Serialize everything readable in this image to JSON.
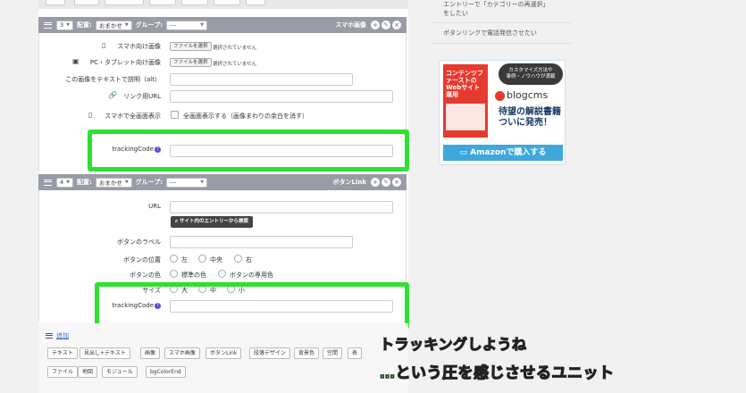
{
  "unit3": {
    "number": "3",
    "placement_label": "配置:",
    "placement_value": "おまかせ",
    "group_label": "グループ:",
    "group_value": "---",
    "type_name": "スマホ画像"
  },
  "unit3_fields": {
    "sp_image_label": "スマホ向け画像",
    "file_btn": "ファイルを選択",
    "no_file": "選択されていません",
    "pc_image_label": "PC・タブレット向け画像",
    "alt_label": "この画像をテキストで説明（alt）",
    "link_label": "リンク用URL",
    "fullscreen_label": "スマホで全画面表示",
    "fullscreen_check": "全画面表示する（画像まわりの余白を消す）",
    "tracking_label": "trackingCode"
  },
  "unit4": {
    "number": "4",
    "placement_label": "配置:",
    "placement_value": "おまかせ",
    "group_label": "グループ:",
    "group_value": "---",
    "type_name": "ボタンLink"
  },
  "unit4_fields": {
    "url_label": "URL",
    "search_btn": "サイト内のエントリーから検索",
    "button_label": "ボタンのラベル",
    "position_label": "ボタンの位置",
    "pos_left": "左",
    "pos_center": "中央",
    "pos_right": "右",
    "color_label": "ボタンの色",
    "color_std": "標準の色",
    "color_special": "ボタンの専用色",
    "size_label": "サイズ",
    "size_l": "大",
    "size_m": "中",
    "size_s": "小",
    "tracking_label": "trackingCode"
  },
  "add_area": {
    "title": "追加",
    "buttons": [
      "テキスト",
      "見出し+テキスト",
      "画像",
      "スマホ画像",
      "ボタンLink",
      "段落デザイン",
      "背景色",
      "空間",
      "表",
      "ファイル",
      "地図",
      "モジュール",
      "bgColorEnd"
    ]
  },
  "sidebar": {
    "text1_line1": "エントリーで「カテゴリーの再選択」",
    "text1_line2": "をしたい",
    "text2": "ボタンリンクで電話発信させたい",
    "banner": {
      "book_title": "コンテンツファーストのWebサイト運用",
      "bubble_line1": "カスタマイズ方法や",
      "bubble_line2": "事例・ノウハウが満載",
      "logo": "blogcms",
      "promo_line1": "待望の解説書籍",
      "promo_line2": "ついに発売！",
      "amazon": "Amazonで購入する"
    }
  },
  "caption": {
    "line1": "トラッキングしようね",
    "line2": "…という圧を感じさせるユニット"
  },
  "colors": {
    "highlight": "#2fe02f",
    "unit_bar": "#999ca7",
    "amazon": "#3ea8dd"
  }
}
